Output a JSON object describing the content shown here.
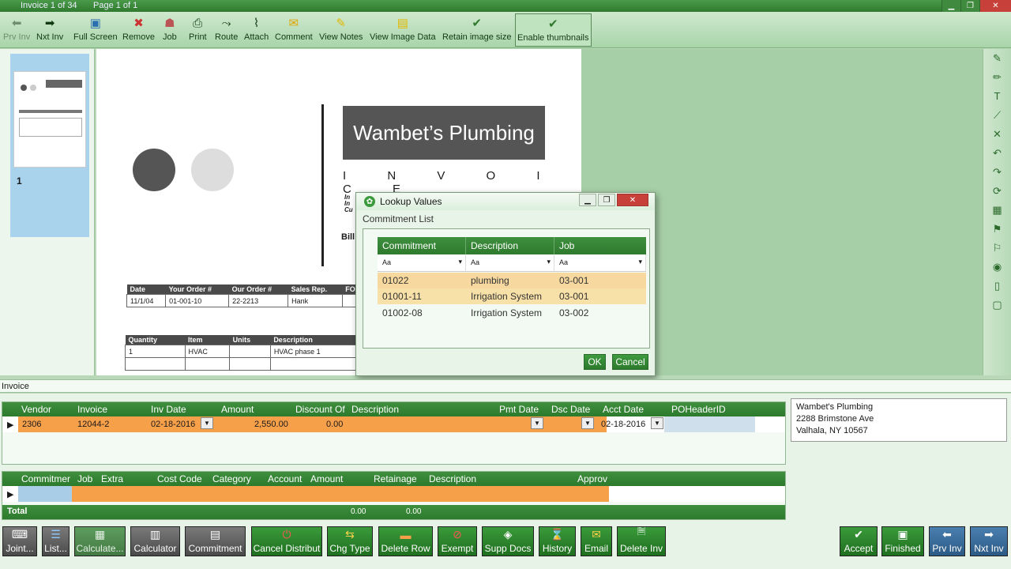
{
  "titlebar": {
    "invoice_count": "Invoice 1 of 34",
    "page_count": "Page 1 of 1"
  },
  "toolbar": [
    {
      "label": "Prv Inv",
      "icon": "arrow-left-icon",
      "glyph": "⬅"
    },
    {
      "label": "Nxt Inv",
      "icon": "arrow-right-icon",
      "glyph": "➡"
    },
    {
      "label": "Full Screen",
      "icon": "fullscreen-icon",
      "glyph": "▣"
    },
    {
      "label": "Remove",
      "icon": "remove-icon",
      "glyph": "✖"
    },
    {
      "label": "Job",
      "icon": "job-icon",
      "glyph": "☗"
    },
    {
      "label": "Print",
      "icon": "print-icon",
      "glyph": "⎙"
    },
    {
      "label": "Route",
      "icon": "route-icon",
      "glyph": "⤳"
    },
    {
      "label": "Attach",
      "icon": "paperclip-icon",
      "glyph": "⌇"
    },
    {
      "label": "Comment",
      "icon": "comment-icon",
      "glyph": "✉"
    },
    {
      "label": "View Notes",
      "icon": "notes-icon",
      "glyph": "✎"
    },
    {
      "label": "View Image Data",
      "icon": "image-data-icon",
      "glyph": "▤"
    },
    {
      "label": "Retain image size",
      "icon": "check-icon",
      "glyph": "✔"
    },
    {
      "label": "Enable thumbnails",
      "icon": "check-icon",
      "glyph": "✔"
    }
  ],
  "thumbnail": {
    "page_number": "1"
  },
  "document": {
    "company": "Wambet’s Plumbing",
    "title": "I N V O I C E",
    "bill_to": "Bill",
    "meta_lines": [
      "In",
      "In",
      "Cu"
    ],
    "order_table": {
      "headers": [
        "Date",
        "Your Order #",
        "Our Order #",
        "Sales Rep.",
        "FO"
      ],
      "row": [
        "11/1/04",
        "01-001-10",
        "22-2213",
        "Hank",
        ""
      ]
    },
    "item_table": {
      "headers": [
        "Quantity",
        "Item",
        "Units",
        "Description"
      ],
      "row": [
        "1",
        "HVAC",
        "",
        "HVAC phase 1"
      ]
    }
  },
  "dialog": {
    "title": "Lookup Values",
    "subtitle": "Commitment List",
    "columns": [
      "Commitment",
      "Description",
      "Job"
    ],
    "filter_placeholder": "Aa",
    "rows": [
      {
        "commitment": "01022",
        "description": "plumbing",
        "job": "03-001"
      },
      {
        "commitment": "01001-11",
        "description": "Irrigation System",
        "job": "03-001"
      },
      {
        "commitment": "01002-08",
        "description": "Irrigation System",
        "job": "03-002"
      }
    ],
    "ok": "OK",
    "cancel": "Cancel"
  },
  "invoice_section": {
    "label": "Invoice",
    "columns": [
      "Vendor",
      "Invoice",
      "Inv Date",
      "Amount",
      "Discount Of",
      "Description",
      "Pmt Date",
      "Dsc Date",
      "Acct Date",
      "POHeaderID"
    ],
    "row": {
      "vendor": "2306",
      "invoice": "12044-2",
      "inv_date": "02-18-2016",
      "amount": "2,550.00",
      "discount": "0.00",
      "description": "",
      "pmt_date": "",
      "dsc_date": "",
      "acct_date": "02-18-2016",
      "po": ""
    }
  },
  "address": {
    "line1": "Wambet's Plumbing",
    "line2": "2288 Brimstone Ave",
    "line3": "Valhala, NY 10567"
  },
  "distribution": {
    "columns": [
      "Commitmer",
      "Job",
      "Extra",
      "Cost Code",
      "Category",
      "Account",
      "Amount",
      "Retainage",
      "Description",
      "Approv"
    ],
    "total_label": "Total",
    "total_amount": "0.00",
    "total_retainage": "0.00"
  },
  "bottom_buttons": [
    {
      "label": "Joint...",
      "style": "gray"
    },
    {
      "label": "List...",
      "style": "gray"
    },
    {
      "label": "Calculate...",
      "style": "gl"
    },
    {
      "label": "Calculator",
      "style": "gray"
    },
    {
      "label": "Commitment",
      "style": "gray"
    },
    {
      "label": "Cancel Distribut",
      "style": "green"
    },
    {
      "label": "Chg Type",
      "style": "green"
    },
    {
      "label": "Delete Row",
      "style": "green"
    },
    {
      "label": "Exempt",
      "style": "green"
    },
    {
      "label": "Supp Docs",
      "style": "green"
    },
    {
      "label": "History",
      "style": "green"
    },
    {
      "label": "Email",
      "style": "green"
    },
    {
      "label": "Delete Inv",
      "style": "green"
    },
    {
      "label": "Accept",
      "style": "green"
    },
    {
      "label": "Finished",
      "style": "green"
    },
    {
      "label": "Prv Inv",
      "style": "blue"
    },
    {
      "label": "Nxt Inv",
      "style": "blue"
    }
  ],
  "colors": {
    "accent": "#2f7a2f",
    "highlight_row": "#f7a04a",
    "selected": "#a9d2ec"
  }
}
